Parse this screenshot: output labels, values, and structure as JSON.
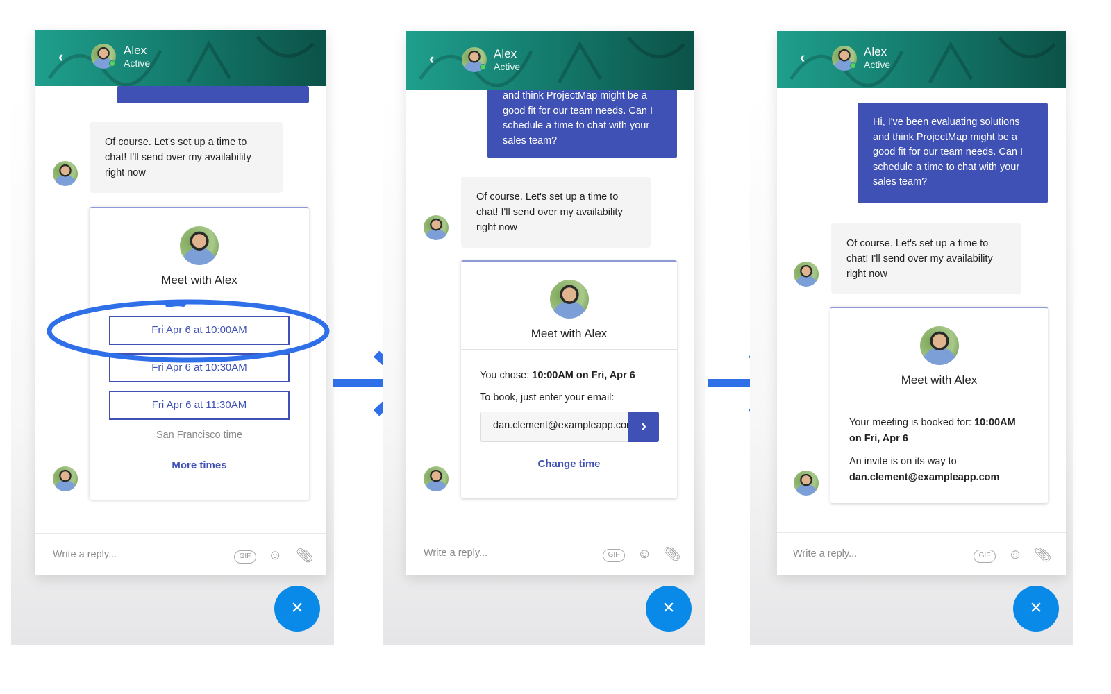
{
  "header": {
    "name": "Alex",
    "status": "Active"
  },
  "colors": {
    "accent": "#3f51b5",
    "header_start": "#1f9f8d",
    "header_end": "#0c5248",
    "fab": "#0a8ae8",
    "annotation": "#2f6fe8",
    "online": "#5bd35b"
  },
  "user_message": [
    "Hi, I've been evaluating solutions",
    "and think ProjectMap might be a",
    "good fit for our team needs. Can I",
    "schedule a time to chat with your",
    "sales team?"
  ],
  "agent_message": [
    "Of course. Let's set up a time to",
    "chat! I'll send over my availability",
    "right now"
  ],
  "card": {
    "title": "Meet with Alex"
  },
  "step1": {
    "slots": [
      "Fri Apr 6 at 10:00AM",
      "Fri Apr 6 at 10:30AM",
      "Fri Apr 6 at 11:30AM"
    ],
    "timezone": "San Francisco time",
    "more": "More times"
  },
  "step2": {
    "chose_label": "You chose:",
    "chose_value": "10:00AM on Fri, Apr 6",
    "prompt": "To book, just enter your email:",
    "email_value": "dan.clement@exampleapp.com",
    "change": "Change time"
  },
  "step3": {
    "booked_label": "Your meeting is booked for:",
    "booked_time": "10:00AM",
    "booked_date": "on Fri, Apr 6",
    "invite": "An invite is on its way to",
    "email": "dan.clement@exampleapp.com"
  },
  "composer": {
    "placeholder": "Write a reply...",
    "gif": "GIF",
    "icons": [
      "gif-icon",
      "emoji-icon",
      "paperclip-icon"
    ]
  },
  "icons": {
    "back": "chevron-left-icon",
    "close": "close-icon",
    "submit": "chevron-right-icon",
    "arrow": "arrow-right-icon"
  }
}
